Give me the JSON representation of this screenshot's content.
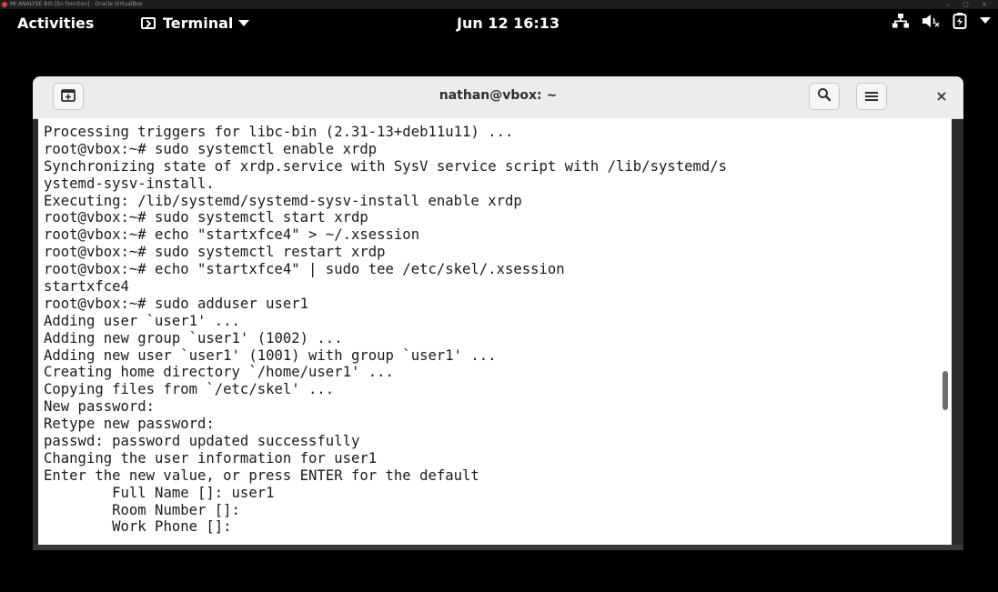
{
  "vbox": {
    "title": "MI ANALYSE BIS [En fonction] - Oracle VirtualBox",
    "controls": "– ▢ ×"
  },
  "topbar": {
    "activities": "Activities",
    "app_name": "Terminal",
    "datetime": "Jun 12  16:13",
    "icons": [
      "network-icon",
      "volume-muted-icon",
      "battery-icon",
      "system-menu-arrow-icon"
    ]
  },
  "window": {
    "title": "nathan@vbox: ~",
    "close": "×",
    "icons": [
      "new-tab-icon",
      "search-icon",
      "hamburger-menu-icon",
      "close-icon"
    ]
  },
  "terminal": {
    "lines": [
      "Processing triggers for libc-bin (2.31-13+deb11u11) ...",
      "root@vbox:~# sudo systemctl enable xrdp",
      "Synchronizing state of xrdp.service with SysV service script with /lib/systemd/s",
      "ystemd-sysv-install.",
      "Executing: /lib/systemd/systemd-sysv-install enable xrdp",
      "root@vbox:~# sudo systemctl start xrdp",
      "root@vbox:~# echo \"startxfce4\" > ~/.xsession",
      "root@vbox:~# sudo systemctl restart xrdp",
      "root@vbox:~# echo \"startxfce4\" | sudo tee /etc/skel/.xsession",
      "startxfce4",
      "root@vbox:~# sudo adduser user1",
      "Adding user `user1' ...",
      "Adding new group `user1' (1002) ...",
      "Adding new user `user1' (1001) with group `user1' ...",
      "Creating home directory `/home/user1' ...",
      "Copying files from `/etc/skel' ...",
      "New password:",
      "Retype new password:",
      "passwd: password updated successfully",
      "Changing the user information for user1",
      "Enter the new value, or press ENTER for the default",
      "\tFull Name []: user1",
      "\tRoom Number []:",
      "\tWork Phone []:"
    ]
  }
}
